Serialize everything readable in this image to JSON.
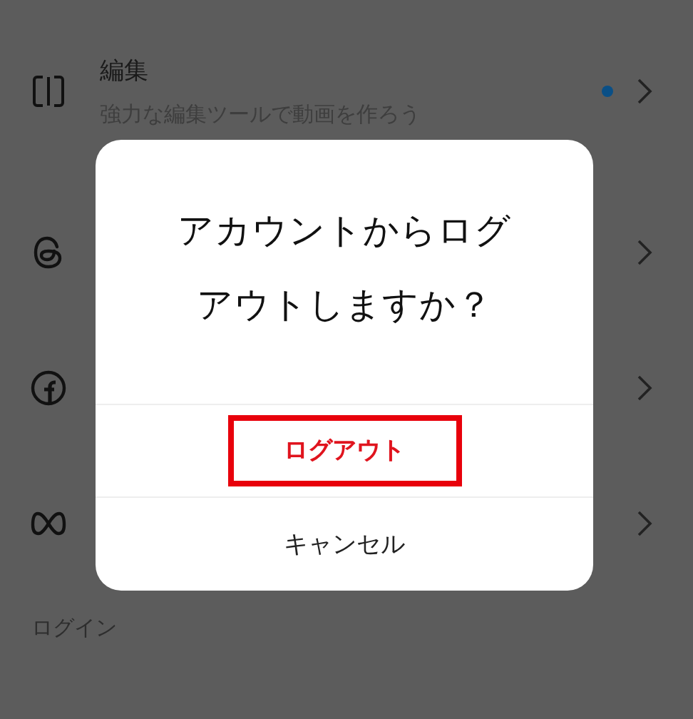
{
  "menu_items": [
    {
      "title": "編集",
      "subtitle": "強力な編集ツールで動画を作ろう",
      "unread": true
    },
    {
      "unread": false
    },
    {
      "unread": false
    },
    {
      "unread": false
    }
  ],
  "section_label": "ログイン",
  "dialog": {
    "title": "アカウントからログアウトしますか？",
    "buttons": [
      {
        "label": "ログアウト",
        "kind": "destructive",
        "highlighted": true
      },
      {
        "label": "キャンセル",
        "kind": "cancel",
        "highlighted": false
      }
    ]
  }
}
